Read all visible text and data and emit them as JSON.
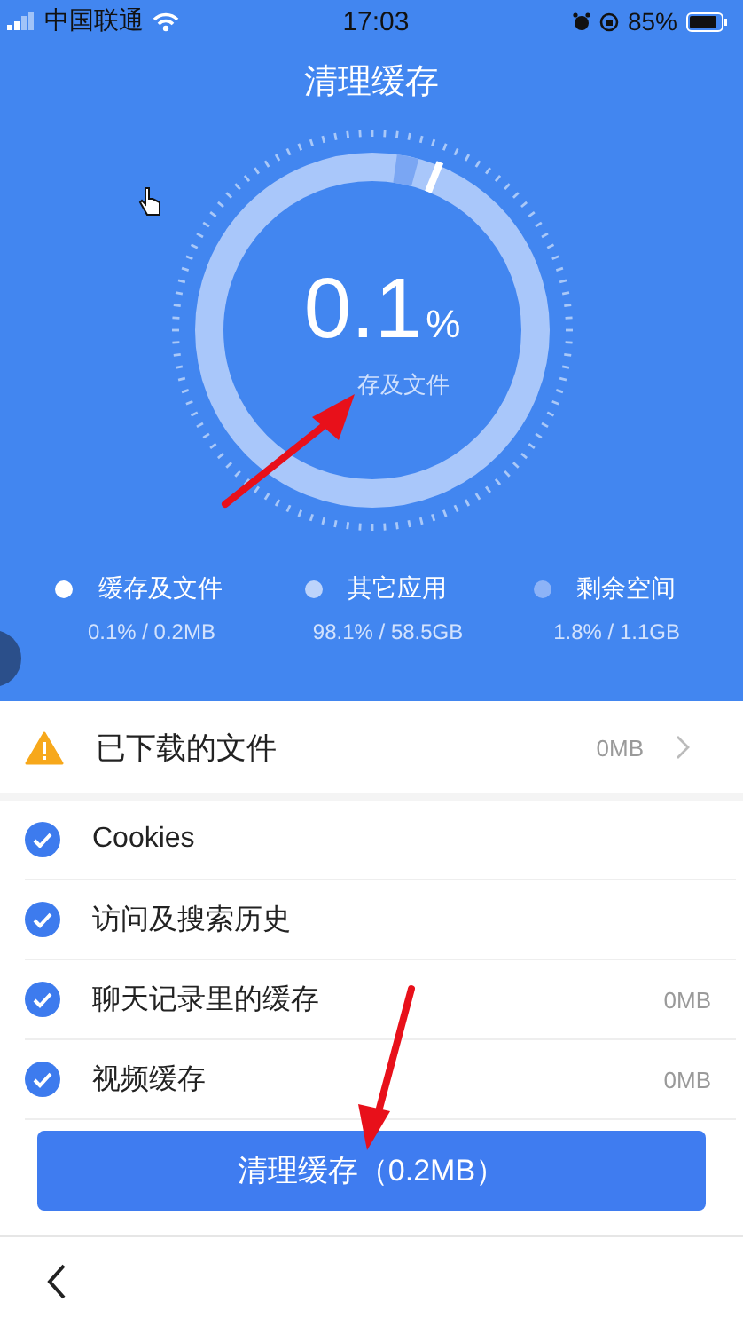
{
  "status_bar": {
    "carrier": "中国联通",
    "time": "17:03",
    "battery": "85%"
  },
  "header": {
    "title": "清理缓存"
  },
  "gauge": {
    "value": "0.1",
    "unit": "%",
    "caption": "存及文件"
  },
  "legend": [
    {
      "label": "缓存及文件",
      "detail": "0.1% / 0.2MB",
      "color": "#ffffff"
    },
    {
      "label": "其它应用",
      "detail": "98.1% / 58.5GB",
      "color": "#bcd3fb"
    },
    {
      "label": "剩余空间",
      "detail": "1.8% / 1.1GB",
      "color": "#8db3f7"
    }
  ],
  "downloads": {
    "label": "已下载的文件",
    "size": "0MB"
  },
  "items": [
    {
      "label": "Cookies",
      "checked": true
    },
    {
      "label": "访问及搜索历史",
      "checked": true
    },
    {
      "label": "聊天记录里的缓存",
      "size": "0MB",
      "checked": true
    },
    {
      "label": "视频缓存",
      "size": "0MB",
      "checked": true
    }
  ],
  "clean_button": {
    "label": "清理缓存（0.2MB）"
  }
}
